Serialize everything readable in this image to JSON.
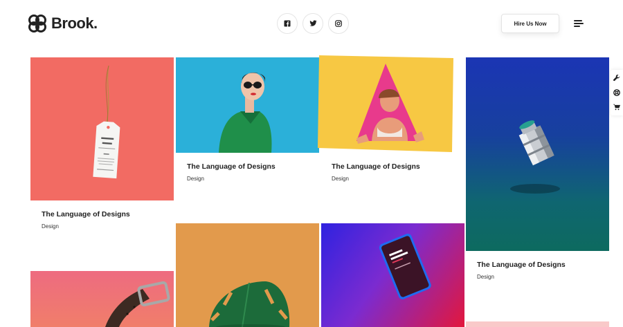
{
  "brand": {
    "name": "Brook."
  },
  "header": {
    "social_icons": [
      "facebook-icon",
      "twitter-icon",
      "instagram-icon"
    ],
    "social_glyphs": [
      "f",
      "t",
      "ig"
    ],
    "hire_button": "Hire Us Now",
    "menu_icon": "hamburger-menu-icon"
  },
  "side_tools": [
    "wrench-icon",
    "lifebuoy-icon",
    "cart-icon"
  ],
  "portfolio": [
    {
      "title": "The Language of Designs",
      "category": "Design",
      "image": "label tag on coral background",
      "color": "#f26b63"
    },
    {
      "title": "The Language of Designs",
      "category": "Design",
      "image": "woman in green jacket with sunglasses",
      "color": "#2bb0d9"
    },
    {
      "title": "The Language of Designs",
      "category": "Design",
      "image": "woman behind pink triangle on yellow",
      "color": "#f7c843"
    },
    {
      "title": "The Language of Designs",
      "category": "Design",
      "image": "metal can on blue gradient",
      "color": "#1a3db1"
    },
    {
      "title": "",
      "category": "",
      "image": "leather watch strap on pink",
      "color": "#ef6f7b"
    },
    {
      "title": "",
      "category": "",
      "image": "monstera leaf on orange",
      "color": "#e29a4c"
    },
    {
      "title": "",
      "category": "",
      "image": "phone mockup on purple-red gradient",
      "color": "#5a2bd0"
    }
  ]
}
